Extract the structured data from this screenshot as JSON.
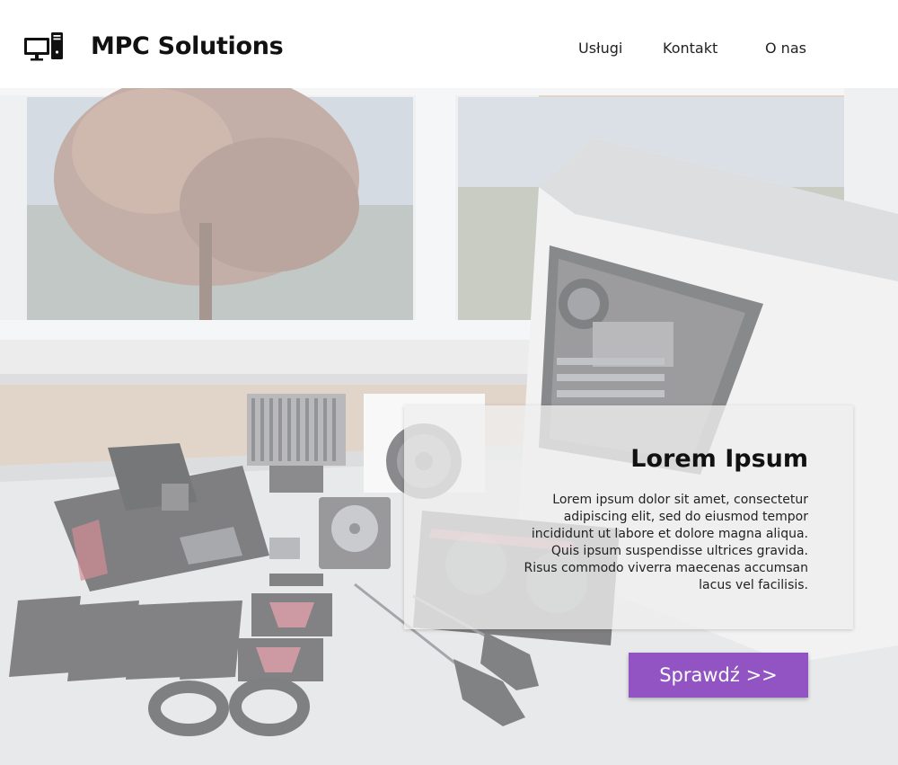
{
  "header": {
    "logo_icon": "desktop-computer-icon",
    "brand": "MPC Solutions",
    "nav": [
      {
        "label": "Usługi"
      },
      {
        "label": "Kontakt"
      },
      {
        "label": "O nas"
      }
    ]
  },
  "hero": {
    "background": "pc-parts-on-table-photo",
    "card": {
      "title": "Lorem Ipsum",
      "text": "Lorem ipsum dolor sit amet, consectetur adipiscing elit, sed do eiusmod tempor incididunt ut labore et dolore magna aliqua. Quis ipsum suspendisse ultrices gravida. Risus commodo viverra maecenas accumsan lacus vel facilisis."
    },
    "cta_label": "Sprawdź >>"
  },
  "colors": {
    "accent": "#9154c2",
    "header_bg": "#ffffff",
    "card_bg": "#eeeeee",
    "text": "#111111"
  }
}
